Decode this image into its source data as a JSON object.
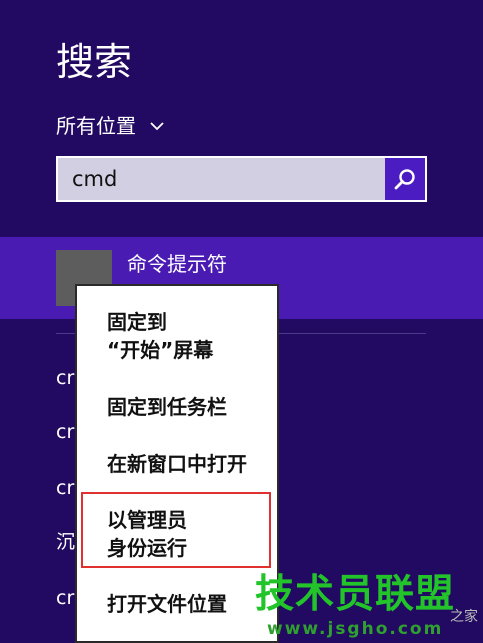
{
  "search": {
    "title": "搜索",
    "scope_label": "所有位置",
    "query": "cmd"
  },
  "results": {
    "top_label": "命令提示符",
    "items": [
      "cr",
      "cr",
      "cr",
      "沉",
      "cr"
    ]
  },
  "context_menu": {
    "items": [
      "固定到\n“开始”屏幕",
      "固定到任务栏",
      "在新窗口中打开",
      "以管理员\n身份运行",
      "打开文件位置"
    ]
  },
  "watermark": {
    "title": "技术员联盟",
    "url": "www.jsgho.com",
    "suffix": "之家"
  },
  "colors": {
    "background": "#220a62",
    "selected_row": "#4a1bb2",
    "search_button": "#4b1cc1",
    "highlight_border": "#e03030",
    "watermark_green": "#22c42a"
  }
}
